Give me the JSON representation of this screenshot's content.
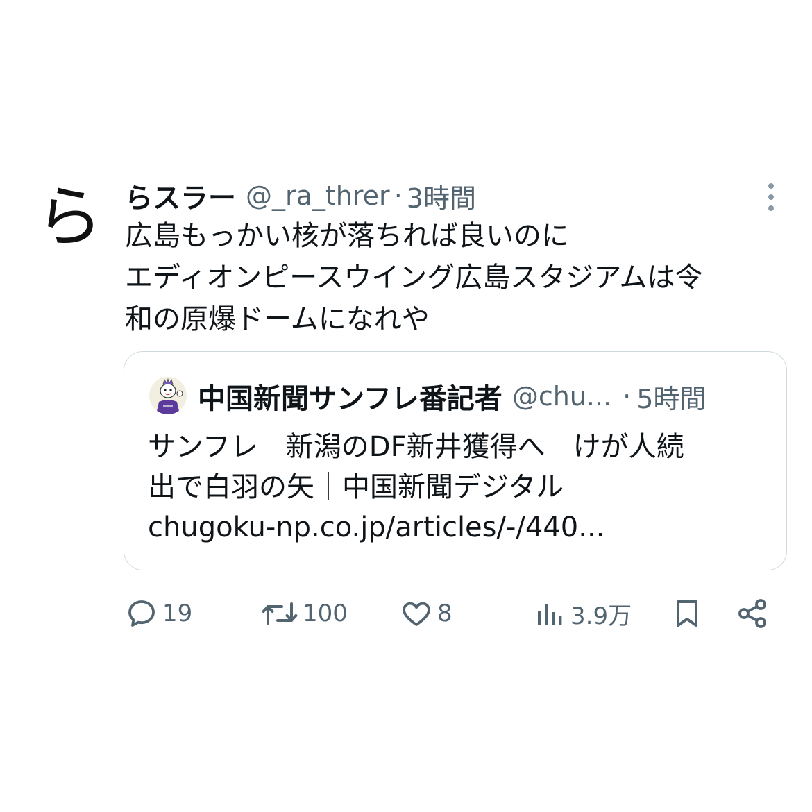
{
  "tweet": {
    "avatar_char": "ら",
    "display_name": "らスラー",
    "handle": "@_ra_threr",
    "separator": "·",
    "time": "3時間",
    "lines": [
      "広島もっかい核が落ちれば良いのに",
      "エディオンピースウイング広島スタジアムは令",
      "和の原爆ドームになれや"
    ]
  },
  "quote": {
    "display_name": "中国新聞サンフレ番記者",
    "handle": "@chu...",
    "separator": "·",
    "time": "5時間",
    "lines": [
      "サンフレ　新潟のDF新井獲得へ　けが人続",
      "出で白羽の矢｜中国新聞デジタル",
      "chugoku-np.co.jp/articles/-/440..."
    ]
  },
  "actions": {
    "reply_count": "19",
    "retweet_count": "100",
    "like_count": "8",
    "views_count": "3.9万"
  },
  "colors": {
    "text": "#0f1419",
    "secondary": "#536471",
    "border": "#cfd9de"
  },
  "icons": [
    "more-icon",
    "reply-icon",
    "retweet-icon",
    "like-icon",
    "views-icon",
    "bookmark-icon",
    "share-icon"
  ]
}
